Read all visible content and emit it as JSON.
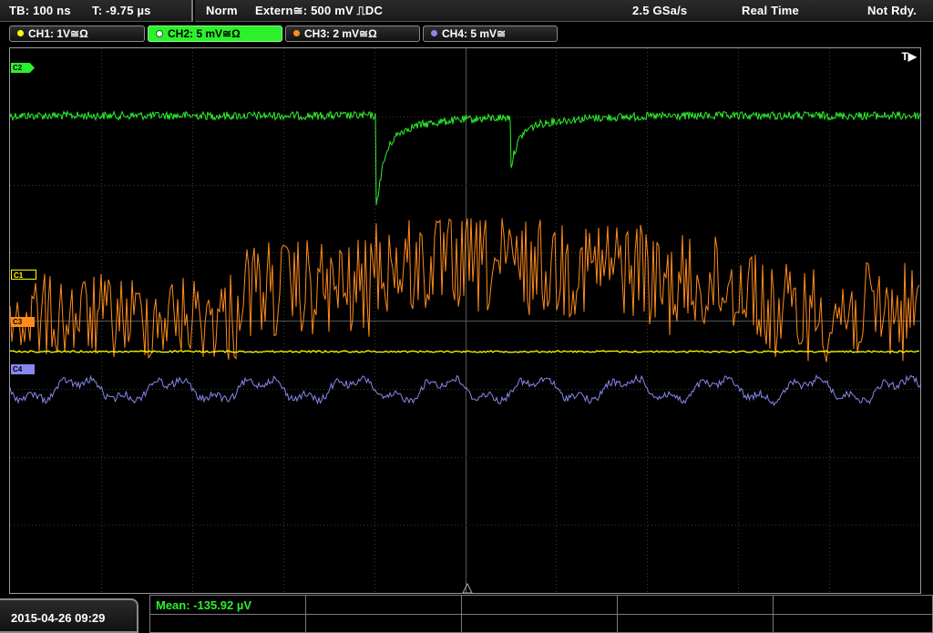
{
  "topbar": {
    "timebase": "TB: 100 ns",
    "trigger_time": "T: -9.75 µs",
    "trigger_mode": "Norm",
    "trigger_source": "Extern≅: 500 mV ⎍DC",
    "sample_rate": "2.5 GSa/s",
    "acq_mode": "Real Time",
    "status": "Not Rdy."
  },
  "channels": [
    {
      "label": "CH1: 1V≅Ω",
      "color": "#ffff00"
    },
    {
      "label": "CH2: 5 mV≅Ω",
      "color": "#2cf02c"
    },
    {
      "label": "CH3: 2 mV≅Ω",
      "color": "#ff8c1a"
    },
    {
      "label": "CH4: 5 mV≅",
      "color": "#8888ee"
    }
  ],
  "markers": {
    "c1": "C1",
    "c2": "C2",
    "c3": "C3",
    "c4": "C4",
    "trigger_flag": "T▶"
  },
  "measurement": {
    "mean": "Mean: -135.92 µV"
  },
  "datetime": "2015-04-26 09:29"
}
